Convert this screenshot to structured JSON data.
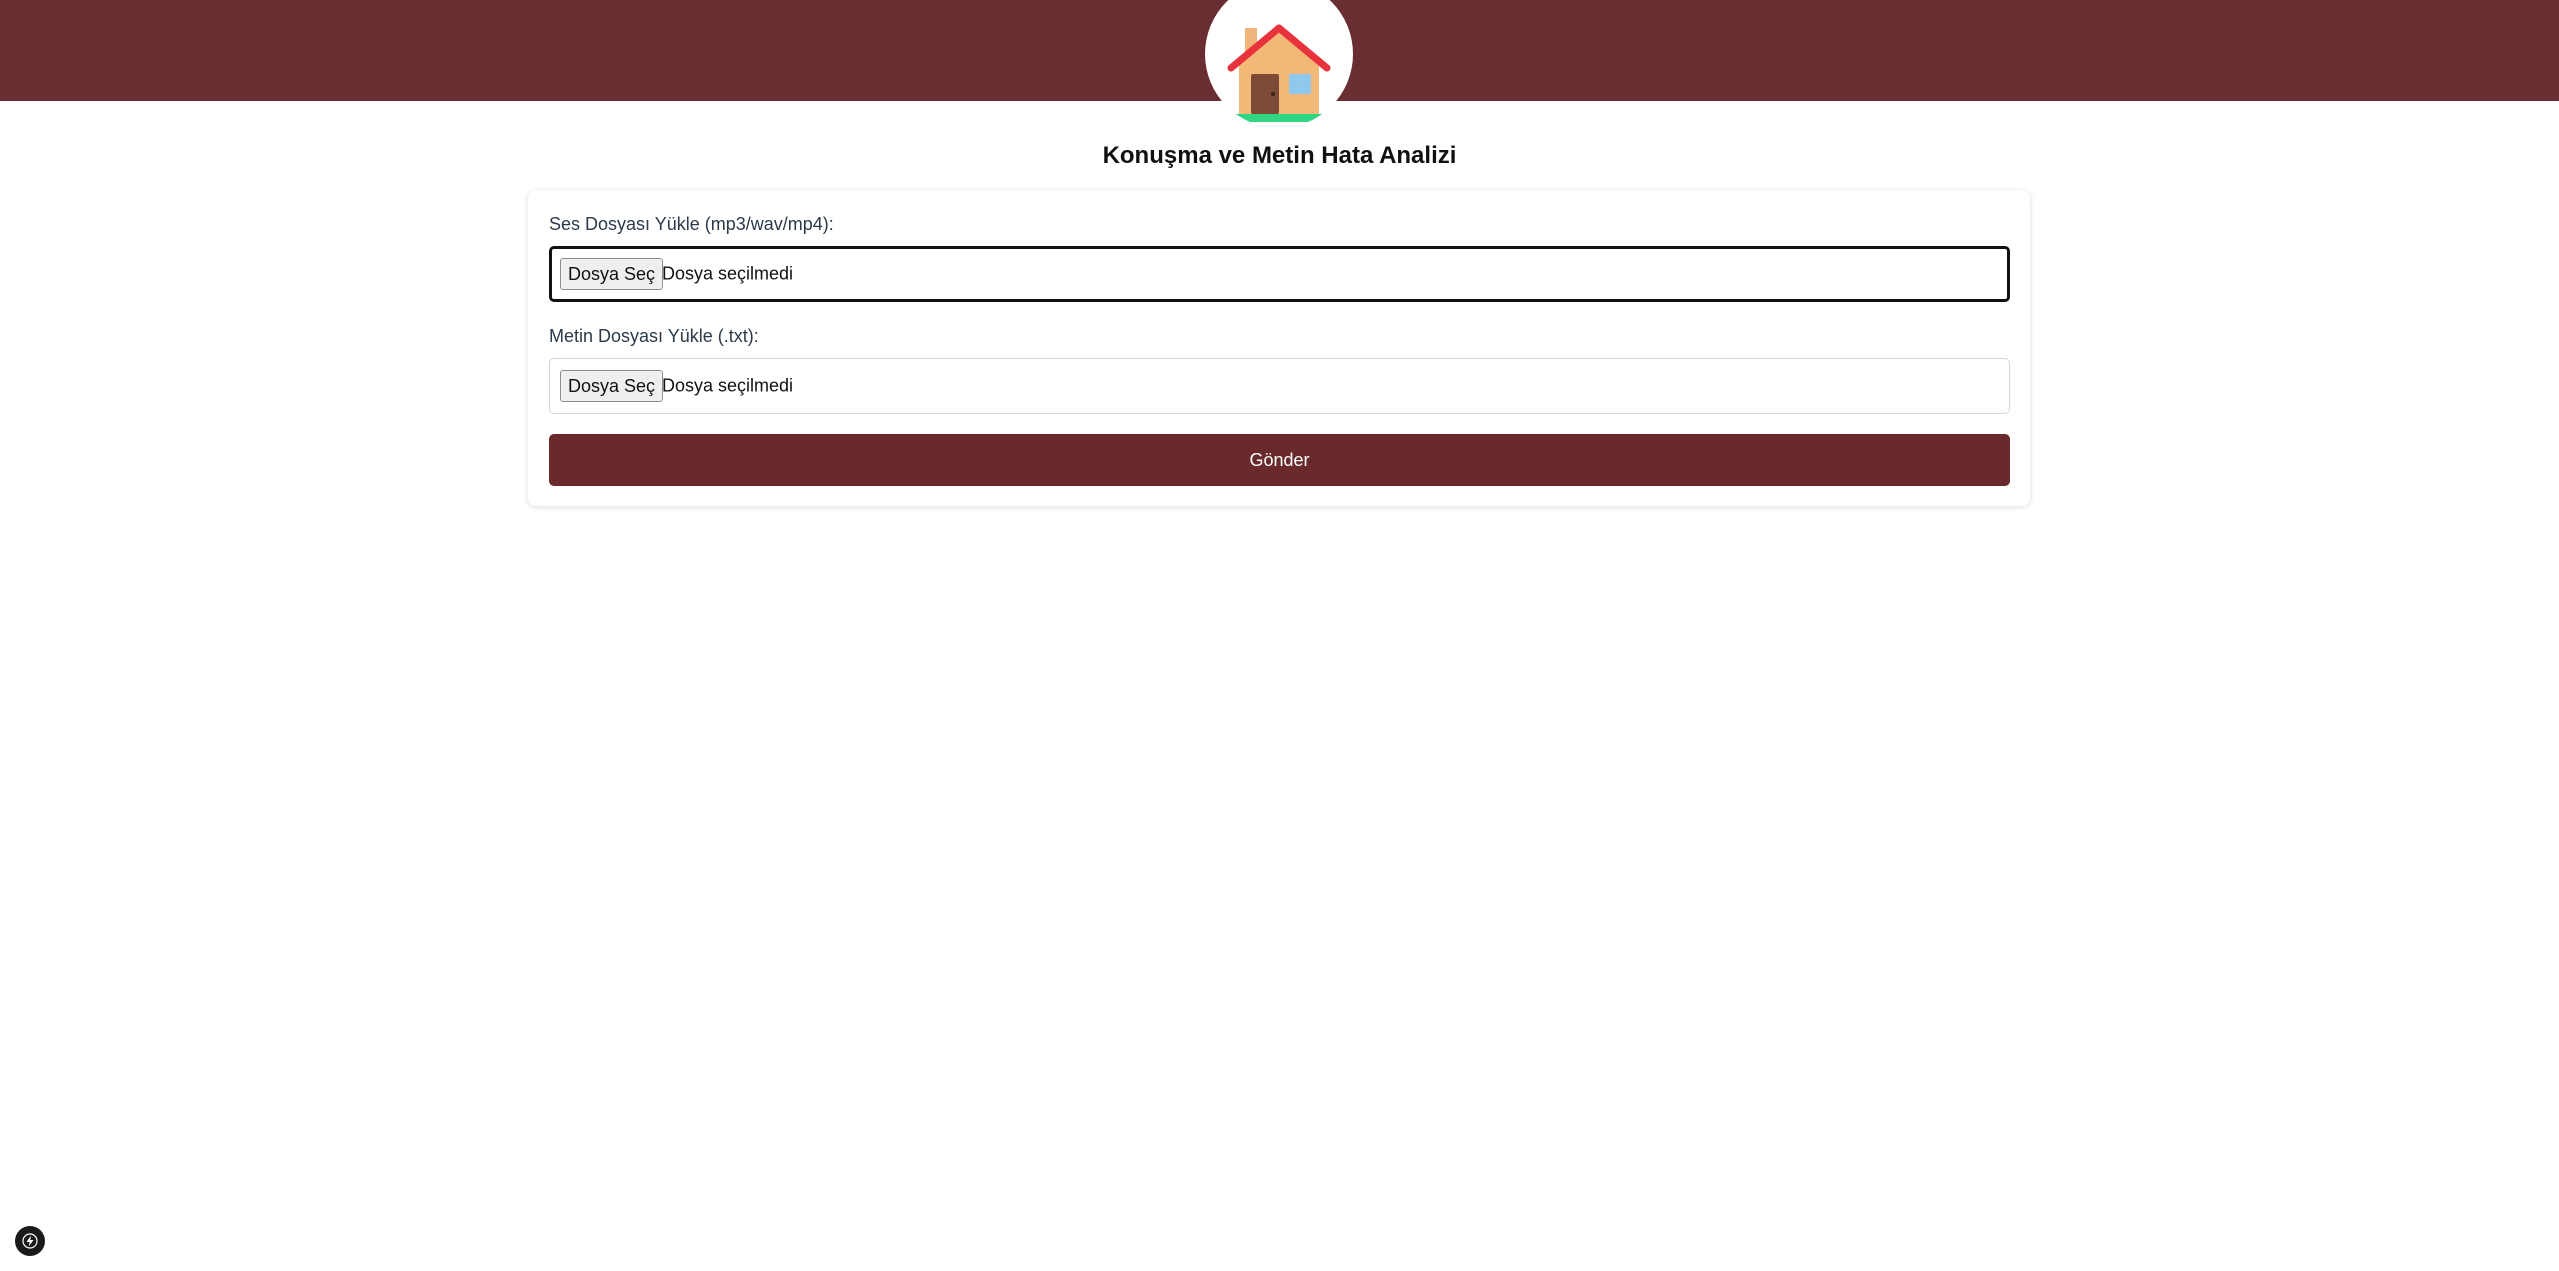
{
  "header": {
    "logo_icon": "house-icon",
    "brand_color": "#6a2d31"
  },
  "page": {
    "title": "Konuşma ve Metin Hata Analizi"
  },
  "form": {
    "audio": {
      "label": "Ses Dosyası Yükle (mp3/wav/mp4):",
      "button_label": "Dosya Seç",
      "status": "Dosya seçilmedi"
    },
    "text": {
      "label": "Metin Dosyası Yükle (.txt):",
      "button_label": "Dosya Seç",
      "status": "Dosya seçilmedi"
    },
    "submit_label": "Gönder",
    "submit_color": "#6a2a2c"
  },
  "dev_indicator": {
    "icon": "lightning-bolt-icon"
  }
}
